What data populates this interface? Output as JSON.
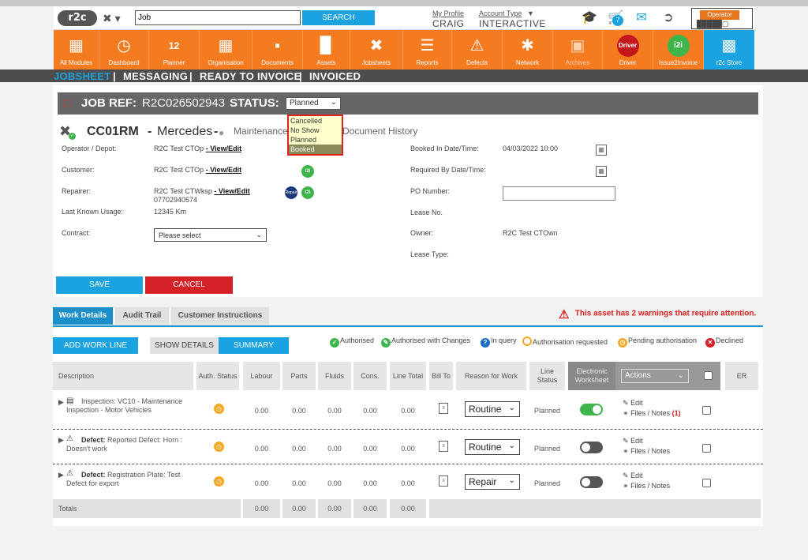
{
  "header": {
    "logo": "r2c",
    "search_value": "Job",
    "search_label": "SEARCH",
    "my_profile_label": "My Profile",
    "user_name": "CRAIG",
    "account_type_label": "Account Type",
    "account_type_value": "INTERACTIVE",
    "notification_count": "7",
    "operator_label": "Operator"
  },
  "nav": {
    "items": [
      {
        "label": "All Modules"
      },
      {
        "label": "Dashboard"
      },
      {
        "label": "Planner",
        "badge": "12"
      },
      {
        "label": "Organisation"
      },
      {
        "label": "Documents"
      },
      {
        "label": "Assets"
      },
      {
        "label": "Jobsheets"
      },
      {
        "label": "Reports"
      },
      {
        "label": "Defects"
      },
      {
        "label": "Network"
      },
      {
        "label": "Archives"
      },
      {
        "label": "Driver",
        "badge": "Driver"
      },
      {
        "label": "Issue2Invoice",
        "badge": "i2i"
      },
      {
        "label": "r2c Store"
      }
    ]
  },
  "subnav": {
    "jobsheet": "JOBSHEET",
    "messaging": "MESSAGING",
    "ready_to_invoice": "READY TO INVOICE",
    "invoiced": "INVOICED",
    "sep": "|"
  },
  "job": {
    "ref_label": "JOB REF:",
    "ref_value": "R2C026502943",
    "status_label": "STATUS:",
    "status_value": "Planned",
    "status_options": [
      "Cancelled",
      "No Show",
      "Planned",
      "Booked"
    ],
    "reg": "CC01RM",
    "dash1": "-",
    "make": "Mercedes",
    "dash2": "-",
    "maintenance_link": "Maintenance",
    "document_history": "Document History"
  },
  "fields": {
    "operator_label": "Operator / Depot:",
    "operator_value": "R2C Test CTOp",
    "customer_label": "Customer:",
    "customer_value": "R2C Test CTOp",
    "repairer_label": "Repairer:",
    "repairer_value": "R2C Test CTWksp",
    "repairer_phone": "07702940574",
    "view_edit": "- View/Edit",
    "usage_label": "Last Known Usage:",
    "usage_value": "12345 Km",
    "contract_label": "Contract:",
    "contract_value": "Please select",
    "booked_label": "Booked In Date/Time:",
    "booked_value": "04/03/2022 10:00",
    "required_label": "Required By Date/Time:",
    "po_label": "PO Number:",
    "lease_no_label": "Lease No.",
    "owner_label": "Owner:",
    "owner_value": "R2C Test CTOwn",
    "lease_type_label": "Lease Type:",
    "badge_i2i": "i2i",
    "badge_repair": "Repair"
  },
  "actions": {
    "save": "SAVE",
    "cancel": "CANCEL"
  },
  "tabs": {
    "work_details": "Work Details",
    "audit_trail": "Audit Trail",
    "customer_instructions": "Customer Instructions"
  },
  "warning": "This asset has 2 warnings that require attention.",
  "toolbar": {
    "add_work_line": "ADD WORK LINE",
    "show_details": "SHOW DETAILS",
    "summary": "SUMMARY"
  },
  "legend": {
    "authorised": "Authorised",
    "authorised_changes": "Authorised with Changes",
    "in_query": "In query",
    "auth_requested": "Authorisation requested",
    "pending": "Pending authorisation",
    "declined": "Declined"
  },
  "table": {
    "headers": {
      "description": "Description",
      "auth_status": "Auth. Status",
      "labour": "Labour",
      "parts": "Parts",
      "fluids": "Fluids",
      "cons": "Cons.",
      "line_total": "Line Total",
      "bill_to": "Bill To",
      "reason": "Reason for Work",
      "line_status": "Line Status",
      "electronic_worksheet": "Electronic Worksheet",
      "actions": "Actions",
      "er": "ER"
    },
    "rows": [
      {
        "type": "",
        "description": "Inspection: VC10 - Maintenance Inspection - Motor Vehicles",
        "labour": "0.00",
        "parts": "0.00",
        "fluids": "0.00",
        "cons": "0.00",
        "total": "0.00",
        "reason": "Routine",
        "line_status": "Planned",
        "ews": true,
        "edit": "Edit",
        "files": "Files / Notes",
        "files_count": "(1)"
      },
      {
        "type": "Defect:",
        "description": "Reported Defect: Horn : Doesn't work",
        "labour": "0.00",
        "parts": "0.00",
        "fluids": "0.00",
        "cons": "0.00",
        "total": "0.00",
        "reason": "Routine",
        "line_status": "Planned",
        "ews": false,
        "edit": "Edit",
        "files": "Files / Notes",
        "files_count": ""
      },
      {
        "type": "Defect:",
        "description": "Registration Plate: Test Defect for export",
        "labour": "0.00",
        "parts": "0.00",
        "fluids": "0.00",
        "cons": "0.00",
        "total": "0.00",
        "reason": "Repair",
        "line_status": "Planned",
        "ews": false,
        "edit": "Edit",
        "files": "Files / Notes",
        "files_count": ""
      }
    ],
    "totals": {
      "label": "Totals",
      "labour": "0.00",
      "parts": "0.00",
      "fluids": "0.00",
      "cons": "0.00",
      "total": "0.00"
    }
  },
  "colors": {
    "brand_orange": "#f47b20",
    "accent_blue": "#1aa3e0",
    "danger_red": "#d42027",
    "success_green": "#3db54a",
    "pending_orange": "#f5a623"
  }
}
